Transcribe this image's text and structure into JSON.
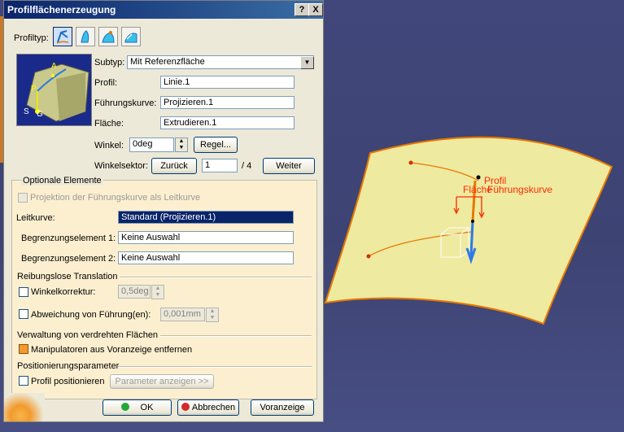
{
  "window": {
    "title": "Profilflächenerzeugung",
    "help_label": "?",
    "close_label": "X"
  },
  "profiltyp": {
    "label": "Profiltyp:"
  },
  "subtyp": {
    "label": "Subtyp:",
    "value": "Mit Referenzfläche"
  },
  "profil": {
    "label": "Profil:",
    "value": "Linie.1"
  },
  "fuehrungskurve": {
    "label": "Führungskurve:",
    "value": "Projizieren.1"
  },
  "flaeche": {
    "label": "Fläche:",
    "value": "Extrudieren.1"
  },
  "winkel": {
    "label": "Winkel:",
    "value": "0deg",
    "law_button": "Regel..."
  },
  "winkelsektor": {
    "label": "Winkelsektor:",
    "back_button": "Zurück",
    "current": "1",
    "total": "/ 4",
    "next_button": "Weiter"
  },
  "optionale": {
    "header": "Optionale Elemente",
    "projektion_label": "Projektion der Führungskurve als Leitkurve",
    "leitkurve_label": "Leitkurve:",
    "leitkurve_value": "Standard (Projizieren.1)",
    "begrenzung1_label": "Begrenzungselement 1:",
    "begrenzung1_value": "Keine Auswahl",
    "begrenzung2_label": "Begrenzungselement 2:",
    "begrenzung2_value": "Keine Auswahl"
  },
  "reibungslos": {
    "header": "Reibungslose Translation",
    "winkelkorrektur_label": "Winkelkorrektur:",
    "winkelkorrektur_value": "0,5deg",
    "abweichung_label": "Abweichung von Führung(en):",
    "abweichung_value": "0,001mm"
  },
  "verwaltung": {
    "header": "Verwaltung von verdrehten Flächen",
    "manipulatoren_label": "Manipulatoren aus Voranzeige entfernen",
    "manipulatoren_checked": true
  },
  "positionierung": {
    "header": "Positionierungsparameter",
    "profil_positionieren_label": "Profil positionieren",
    "parameter_button": "Parameter anzeigen >>"
  },
  "footer": {
    "ok": "OK",
    "abbrechen": "Abbrechen",
    "voranzeige": "Voranzeige"
  },
  "diagram": {
    "a": "A",
    "p": "P",
    "s": "S",
    "g": "G"
  },
  "viewport": {
    "profil": "Profil",
    "flaeche": "Fläche",
    "fuehrungskurve": "Führungskurve"
  },
  "colors": {
    "surface": "#eeeaa0",
    "edge": "#e67800",
    "label": "#ff2a00",
    "arrow_blue": "#2d7be6"
  }
}
